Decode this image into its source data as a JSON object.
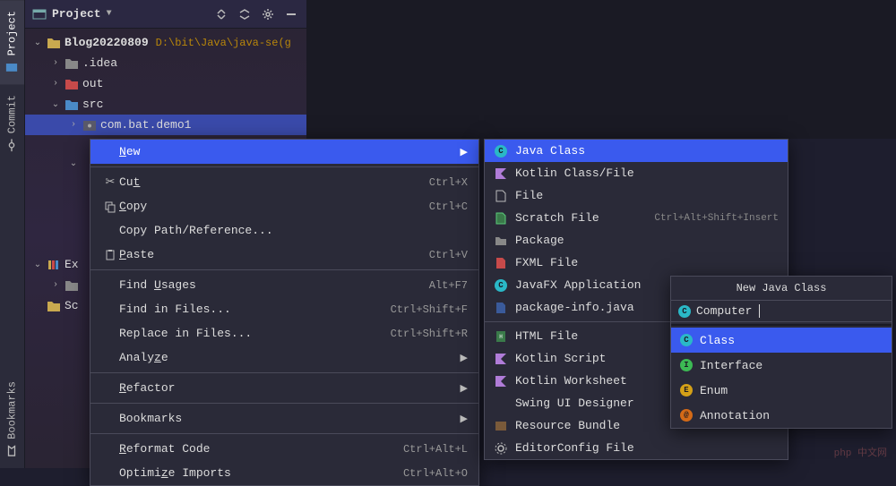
{
  "gutter": {
    "project": "Project",
    "commit": "Commit",
    "bookmarks": "Bookmarks"
  },
  "panel": {
    "title": "Project"
  },
  "tree": {
    "root": {
      "name": "Blog20220809",
      "path": "D:\\bit\\Java\\java-se(g"
    },
    "idea": ".idea",
    "out": "out",
    "src": "src",
    "pkg": "com.bat.demo1",
    "ext": "Ex",
    "scratch": "Sc"
  },
  "menu": {
    "new": "New",
    "cut": "Cut",
    "cut_sc": "Ctrl+X",
    "copy": "Copy",
    "copy_sc": "Ctrl+C",
    "copypath": "Copy Path/Reference...",
    "paste": "Paste",
    "paste_sc": "Ctrl+V",
    "findusages": "Find Usages",
    "findusages_sc": "Alt+F7",
    "findinfiles": "Find in Files...",
    "findinfiles_sc": "Ctrl+Shift+F",
    "replaceinfiles": "Replace in Files...",
    "replaceinfiles_sc": "Ctrl+Shift+R",
    "analyze": "Analyze",
    "refactor": "Refactor",
    "bookmarks": "Bookmarks",
    "reformat": "Reformat Code",
    "reformat_sc": "Ctrl+Alt+L",
    "optimize": "Optimize Imports",
    "optimize_sc": "Ctrl+Alt+O"
  },
  "submenu": {
    "javaclass": "Java Class",
    "kotlinclass": "Kotlin Class/File",
    "file": "File",
    "scratchfile": "Scratch File",
    "scratchfile_sc": "Ctrl+Alt+Shift+Insert",
    "package": "Package",
    "fxml": "FXML File",
    "javafx": "JavaFX Application",
    "pkginfo": "package-info.java",
    "htmlfile": "HTML File",
    "kotlinscript": "Kotlin Script",
    "kotlinworksheet": "Kotlin Worksheet",
    "swing": "Swing UI Designer",
    "resbundle": "Resource Bundle",
    "editorconfig": "EditorConfig File"
  },
  "popup": {
    "title": "New Java Class",
    "input": "Computer",
    "class": "Class",
    "interface": "Interface",
    "enum": "Enum",
    "annotation": "Annotation"
  },
  "watermark": "php 中文网"
}
